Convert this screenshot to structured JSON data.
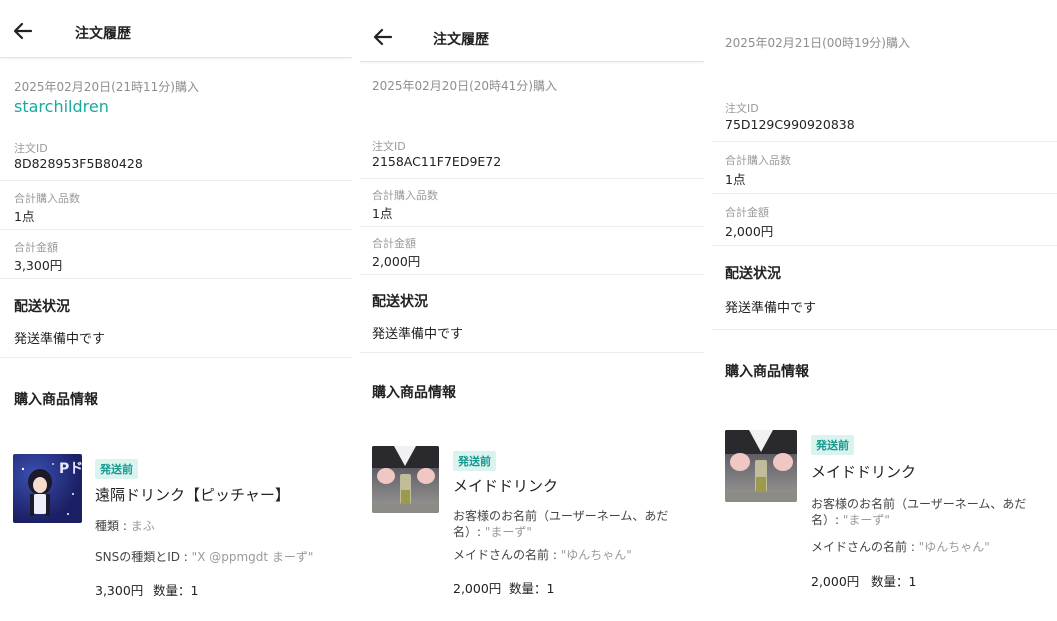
{
  "header": {
    "title": "注文履歴"
  },
  "orders": [
    {
      "date": "2025年02月20日(21時11分)購入",
      "shop": "starchildren",
      "order_id_label": "注文ID",
      "order_id": "8D828953F5B80428",
      "qty_label": "合計購入品数",
      "qty": "1点",
      "total_label": "合計金額",
      "total": "3,300円",
      "shipping_heading": "配送状況",
      "shipping_status": "発送準備中です",
      "product_heading": "購入商品情報",
      "item": {
        "badge": "発送前",
        "name": "遠隔ドリンク【ピッチャー】",
        "thumb_text": "Pドリ",
        "options": [
          {
            "label": "種類 : ",
            "value": "まふ"
          },
          {
            "label": "SNSの種類とID : ",
            "value": "\"X @ppmgdt まーず\""
          }
        ],
        "price": "3,300円",
        "quantity": "数量：1"
      }
    },
    {
      "date": "2025年02月20日(20時41分)購入",
      "order_id_label": "注文ID",
      "order_id": "2158AC11F7ED9E72",
      "qty_label": "合計購入品数",
      "qty": "1点",
      "total_label": "合計金額",
      "total": "2,000円",
      "shipping_heading": "配送状況",
      "shipping_status": "発送準備中です",
      "product_heading": "購入商品情報",
      "item": {
        "badge": "発送前",
        "name": "メイドドリンク",
        "options": [
          {
            "label": "お客様のお名前（ユーザーネーム、あだ名）: ",
            "value": "\"まーず\""
          },
          {
            "label": "メイドさんの名前 : ",
            "value": "\"ゆんちゃん\""
          }
        ],
        "price": "2,000円",
        "quantity": "数量：1"
      }
    },
    {
      "date": "2025年02月21日(00時19分)購入",
      "order_id_label": "注文ID",
      "order_id": "75D129C990920838",
      "qty_label": "合計購入品数",
      "qty": "1点",
      "total_label": "合計金額",
      "total": "2,000円",
      "shipping_heading": "配送状況",
      "shipping_status": "発送準備中です",
      "product_heading": "購入商品情報",
      "item": {
        "badge": "発送前",
        "name": "メイドドリンク",
        "options": [
          {
            "label": "お客様のお名前（ユーザーネーム、あだ名）: ",
            "value": "\"まーず\""
          },
          {
            "label": "メイドさんの名前 : ",
            "value": "\"ゆんちゃん\""
          }
        ],
        "price": "2,000円",
        "quantity": "数量：1"
      }
    }
  ],
  "colors": {
    "accent": "#18a9a0",
    "badge_bg": "#d9f3ef",
    "muted": "#9a9a9a"
  },
  "icons": {
    "back": "arrow-left-icon"
  }
}
